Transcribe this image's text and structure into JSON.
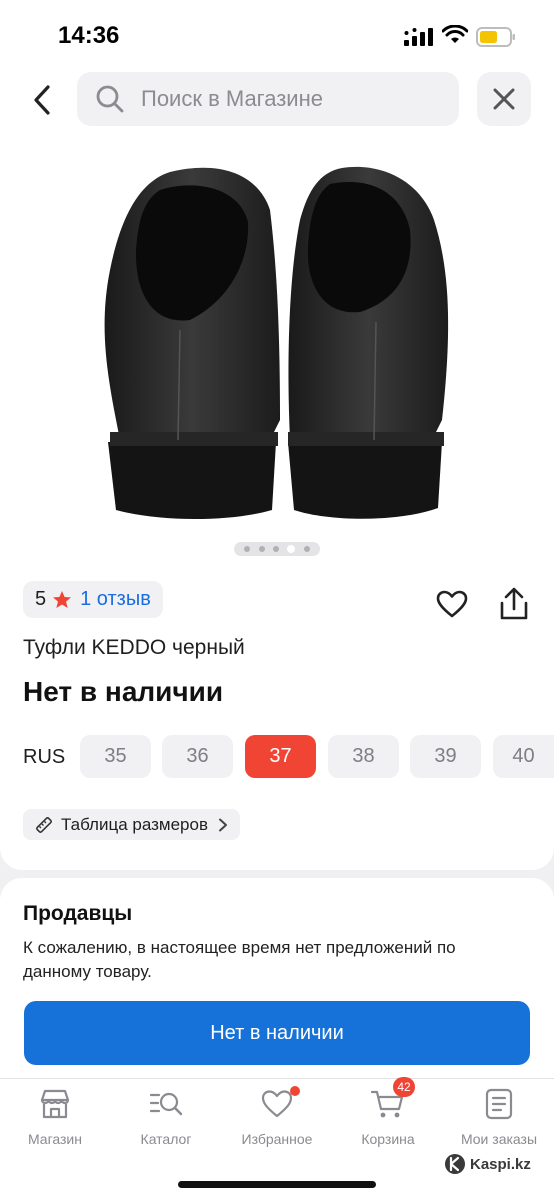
{
  "status": {
    "time": "14:36"
  },
  "header": {
    "search_placeholder": "Поиск в Магазине"
  },
  "gallery": {
    "count": 5,
    "active_index": 3
  },
  "rating": {
    "value": "5",
    "reviews": "1 отзыв"
  },
  "product": {
    "title": "Туфли KEDDO черный",
    "availability": "Нет в наличии"
  },
  "sizes": {
    "label": "RUS",
    "options": [
      "35",
      "36",
      "37",
      "38",
      "39",
      "40"
    ],
    "selected": "37",
    "table_label": "Таблица размеров"
  },
  "sellers": {
    "title": "Продавцы",
    "text": "К сожалению, в настоящее время нет предложений по данному товару.",
    "button": "Нет в наличии"
  },
  "tabbar": {
    "tabs": [
      {
        "label": "Магазин",
        "icon": "shop-icon"
      },
      {
        "label": "Каталог",
        "icon": "catalog-search-icon"
      },
      {
        "label": "Избранное",
        "icon": "heart-icon"
      },
      {
        "label": "Корзина",
        "icon": "cart-icon"
      },
      {
        "label": "Мои заказы",
        "icon": "orders-icon"
      }
    ],
    "cart_count": "42"
  },
  "watermark": "Kaspi.kz",
  "colors": {
    "accent_red": "#f04535",
    "primary_blue": "#1672d8",
    "link_blue": "#1a6ee0"
  }
}
